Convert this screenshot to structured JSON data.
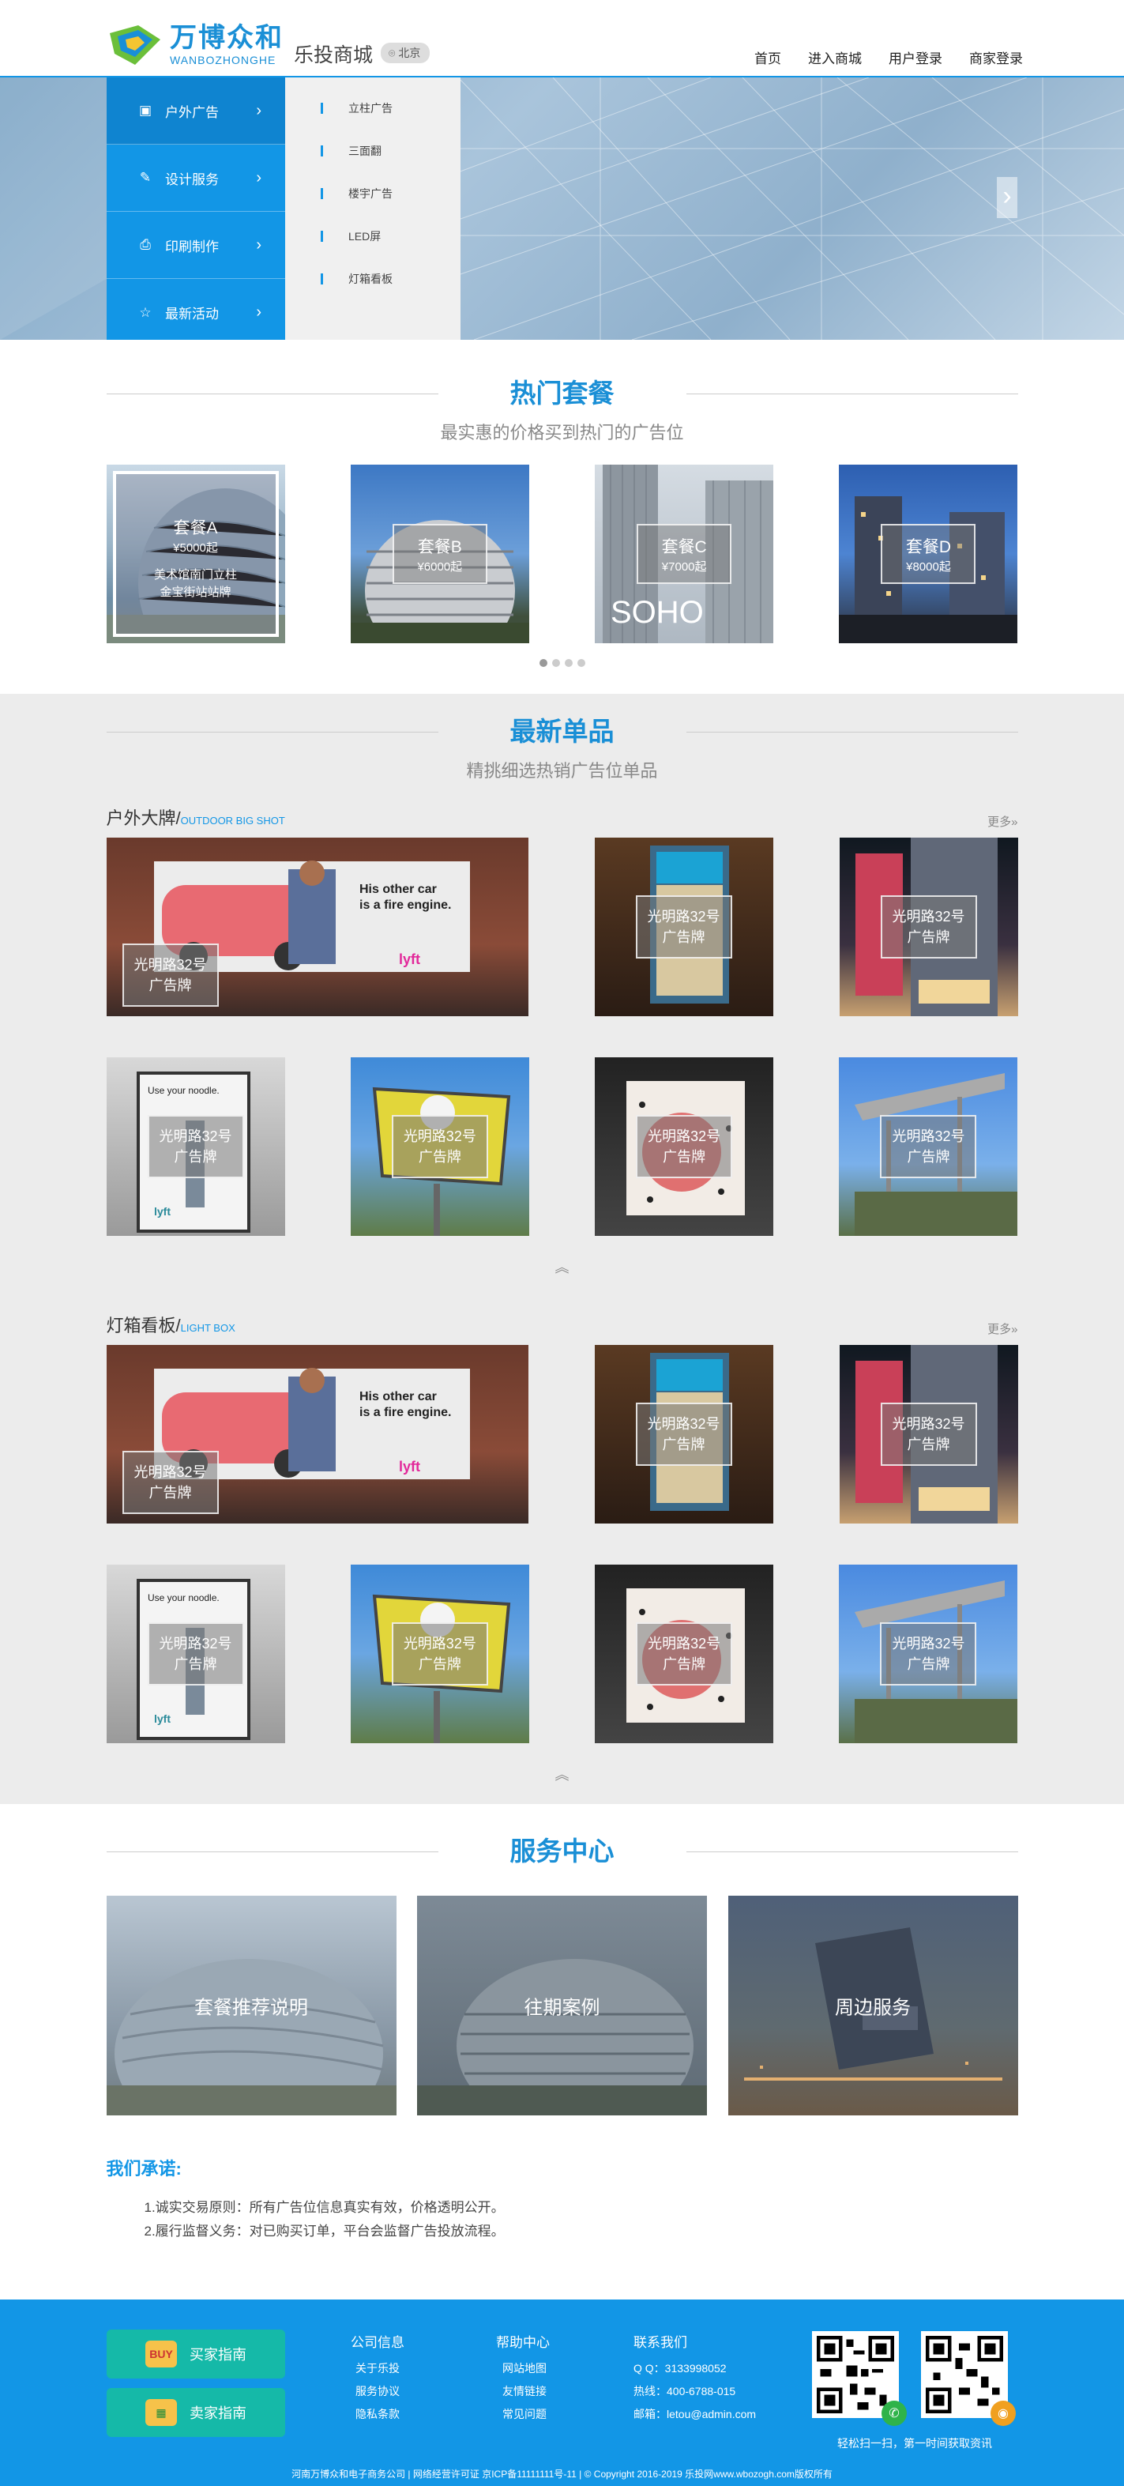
{
  "header": {
    "logo_cn": "万博众和",
    "logo_en": "WANBOZHONGHE",
    "subtitle": "乐投商城",
    "city": "北京",
    "nav": [
      "首页",
      "进入商城",
      "用户登录",
      "商家登录"
    ]
  },
  "banner": {
    "menu": [
      "户外广告",
      "设计服务",
      "印刷制作",
      "最新活动"
    ],
    "submenu": [
      "立柱广告",
      "三面翻",
      "楼宇广告",
      "LED屏",
      "灯箱看板"
    ],
    "next": "›"
  },
  "hot": {
    "title": "热门套餐",
    "subtitle": "最实惠的价格买到热门的广告位",
    "packages": [
      {
        "name": "套餐A",
        "price": "¥5000起",
        "desc1": "美术馆南门立柱",
        "desc2": "金宝街站站牌"
      },
      {
        "name": "套餐B",
        "price": "¥6000起"
      },
      {
        "name": "套餐C",
        "price": "¥7000起"
      },
      {
        "name": "套餐D",
        "price": "¥8000起"
      }
    ]
  },
  "latest": {
    "title": "最新单品",
    "subtitle": "精挑细选热销广告位单品",
    "more": "更多»",
    "up": "︽",
    "categories": [
      {
        "name": "户外大牌/",
        "en": "OUTDOOR BIG SHOT"
      },
      {
        "name": "灯箱看板/",
        "en": "LIGHT BOX"
      }
    ],
    "card_line1": "光明路32号",
    "card_line2": "广告牌"
  },
  "service": {
    "title": "服务中心",
    "cards": [
      "套餐推荐说明",
      "往期案例",
      "周边服务"
    ],
    "promise_title": "我们承诺:",
    "promise_items": [
      "1.诚实交易原则：所有广告位信息真实有效，价格透明公开。",
      "2.履行监督义务：对已购买订单，平台会监督广告投放流程。"
    ]
  },
  "footer": {
    "buy_btn": "买家指南",
    "sell_btn": "卖家指南",
    "buy_icon": "BUY",
    "col1": {
      "title": "公司信息",
      "links": [
        "关于乐投",
        "服务协议",
        "隐私条款"
      ]
    },
    "col2": {
      "title": "帮助中心",
      "links": [
        "网站地图",
        "友情链接",
        "常见问题"
      ]
    },
    "col3": {
      "title": "联系我们",
      "links": [
        "Q Q：3133998052",
        "热线：400-6788-015",
        "邮箱：letou@admin.com"
      ]
    },
    "qr_note": "轻松扫一扫，第一时间获取资讯",
    "copyright": "河南万博众和电子商务公司 | 网络经营许可证 京ICP备11111111号-11 | © Copyright 2016-2019 乐投网www.wbozogh.com版权所有"
  }
}
